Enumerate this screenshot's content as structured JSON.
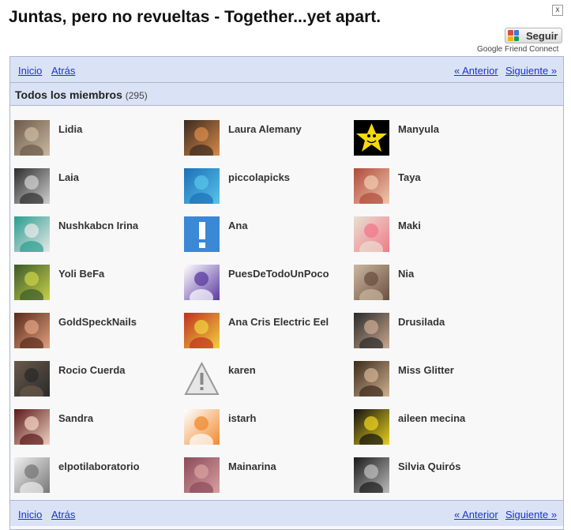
{
  "page": {
    "title": "Juntas, pero no revueltas - Together...yet apart.",
    "close_label": "x",
    "follow_label": "Seguir",
    "gfc_label": "Google Friend Connect"
  },
  "nav": {
    "home": "Inicio",
    "back": "Atrás",
    "prev": "« Anterior",
    "next": "Siguiente »"
  },
  "section": {
    "title": "Todos los miembros",
    "count": "(295)"
  },
  "colors": {
    "nav_bg": "#dae3f5",
    "border": "#a9b7d1",
    "link": "#1a33cc"
  },
  "members": [
    {
      "name": "Lidia",
      "avatar": "photo"
    },
    {
      "name": "Laura Alemany",
      "avatar": "photo"
    },
    {
      "name": "Manyula",
      "avatar": "star-icon"
    },
    {
      "name": "Laia",
      "avatar": "photo"
    },
    {
      "name": "piccolapicks",
      "avatar": "photo"
    },
    {
      "name": "Taya",
      "avatar": "photo"
    },
    {
      "name": "Nushkabcn Irina",
      "avatar": "photo"
    },
    {
      "name": "Ana",
      "avatar": "exclamation-icon"
    },
    {
      "name": "Maki",
      "avatar": "photo"
    },
    {
      "name": "Yoli BeFa",
      "avatar": "photo"
    },
    {
      "name": "PuesDeTodoUnPoco",
      "avatar": "photo"
    },
    {
      "name": "Nia",
      "avatar": "photo"
    },
    {
      "name": "GoldSpeckNails",
      "avatar": "photo"
    },
    {
      "name": "Ana Cris Electric Eel",
      "avatar": "photo"
    },
    {
      "name": "Drusilada",
      "avatar": "photo"
    },
    {
      "name": "Rocio Cuerda",
      "avatar": "photo"
    },
    {
      "name": "karen",
      "avatar": "warning-icon"
    },
    {
      "name": "Miss Glitter",
      "avatar": "photo"
    },
    {
      "name": "Sandra",
      "avatar": "photo"
    },
    {
      "name": "istarh",
      "avatar": "photo"
    },
    {
      "name": "aileen mecina",
      "avatar": "photo"
    },
    {
      "name": "elpotilaboratorio",
      "avatar": "photo"
    },
    {
      "name": "Mainarina",
      "avatar": "photo"
    },
    {
      "name": "Silvia Quirós",
      "avatar": "photo"
    }
  ]
}
